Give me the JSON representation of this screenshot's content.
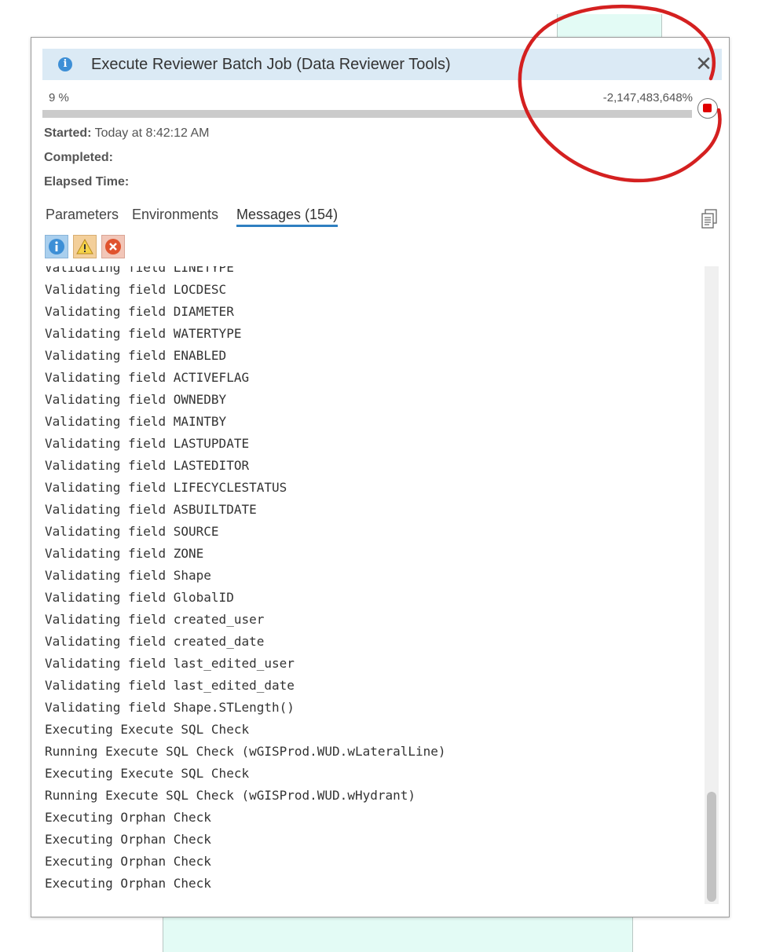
{
  "dialog": {
    "title": "Execute Reviewer Batch Job (Data Reviewer Tools)",
    "close_label": "✕",
    "progress": {
      "left_text": "9 %",
      "right_text": "-2,147,483,648%"
    },
    "started_label": "Started:",
    "started_value": "Today at 8:42:12 AM",
    "completed_label": "Completed:",
    "completed_value": "",
    "elapsed_label": "Elapsed Time:",
    "elapsed_value": ""
  },
  "tabs": [
    {
      "label": "Parameters"
    },
    {
      "label": "Environments"
    },
    {
      "label": "Messages (154)",
      "active": true
    }
  ],
  "filters": [
    {
      "name": "info",
      "icon": "info-icon"
    },
    {
      "name": "warning",
      "icon": "warning-icon"
    },
    {
      "name": "error",
      "icon": "error-icon"
    }
  ],
  "messages": [
    "Validating field LINETYPE",
    "Validating field LOCDESC",
    "Validating field DIAMETER",
    "Validating field WATERTYPE",
    "Validating field ENABLED",
    "Validating field ACTIVEFLAG",
    "Validating field OWNEDBY",
    "Validating field MAINTBY",
    "Validating field LASTUPDATE",
    "Validating field LASTEDITOR",
    "Validating field LIFECYCLESTATUS",
    "Validating field ASBUILTDATE",
    "Validating field SOURCE",
    "Validating field ZONE",
    "Validating field Shape",
    "Validating field GlobalID",
    "Validating field created_user",
    "Validating field created_date",
    "Validating field last_edited_user",
    "Validating field last_edited_date",
    "Validating field Shape.STLength()",
    "Executing Execute SQL Check",
    "Running Execute SQL Check (wGISProd.WUD.wLateralLine)",
    "Executing Execute SQL Check",
    "Running Execute SQL Check (wGISProd.WUD.wHydrant)",
    "Executing Orphan Check",
    "Executing Orphan Check",
    "Executing Orphan Check",
    "Executing Orphan Check"
  ],
  "colors": {
    "titlebar": "#dbeaf5",
    "accent": "#2f7fc1",
    "stop": "#e00000",
    "annotation": "#d42020"
  }
}
